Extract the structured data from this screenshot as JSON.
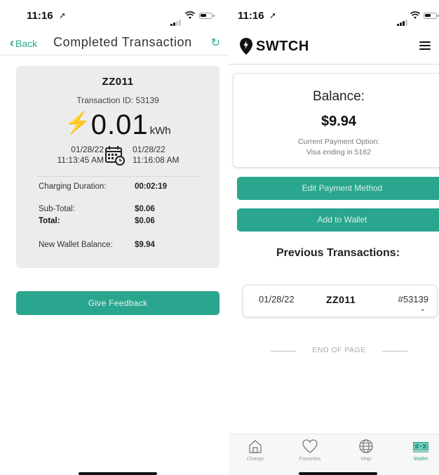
{
  "left": {
    "status": {
      "time": "11:16"
    },
    "nav": {
      "back_label": "Back",
      "title": "Completed Transaction"
    },
    "card": {
      "station": "ZZ011",
      "transaction_id": "Transaction ID: 53139",
      "energy_value": "0.01",
      "energy_unit": "kWh",
      "start_date": "01/28/22",
      "start_time": "11:13:45 AM",
      "end_date": "01/28/22",
      "end_time": "11:16:08 AM",
      "rows": [
        {
          "label": "Charging Duration:",
          "value": "00:02:19"
        },
        {
          "label": "Sub-Total:",
          "value": "$0.06"
        },
        {
          "label": "Total:",
          "value": "$0.06"
        },
        {
          "label": "New Wallet Balance:",
          "value": "$9.94"
        }
      ]
    },
    "feedback_label": "Give Feedback"
  },
  "right": {
    "status": {
      "time": "11:16"
    },
    "brand": "SWTCH",
    "balance": {
      "title": "Balance:",
      "amount": "$9.94",
      "payment_label": "Current Payment Option:",
      "payment_value": "Visa ending in 5162"
    },
    "edit_payment_label": "Edit Payment Method",
    "add_wallet_label": "Add to Wallet",
    "previous_title": "Previous Transactions:",
    "transactions": [
      {
        "date": "01/28/22",
        "station": "ZZ011",
        "id": "#53139"
      }
    ],
    "end_of_page": "END OF PAGE",
    "tabs": [
      {
        "label": "Charge",
        "icon": "home-icon"
      },
      {
        "label": "Favorites",
        "icon": "heart-icon"
      },
      {
        "label": "Map",
        "icon": "globe-icon"
      },
      {
        "label": "Wallet",
        "icon": "wallet-icon",
        "active": true
      }
    ]
  },
  "colors": {
    "accent": "#2aa68e",
    "card_bg": "#ececec"
  }
}
